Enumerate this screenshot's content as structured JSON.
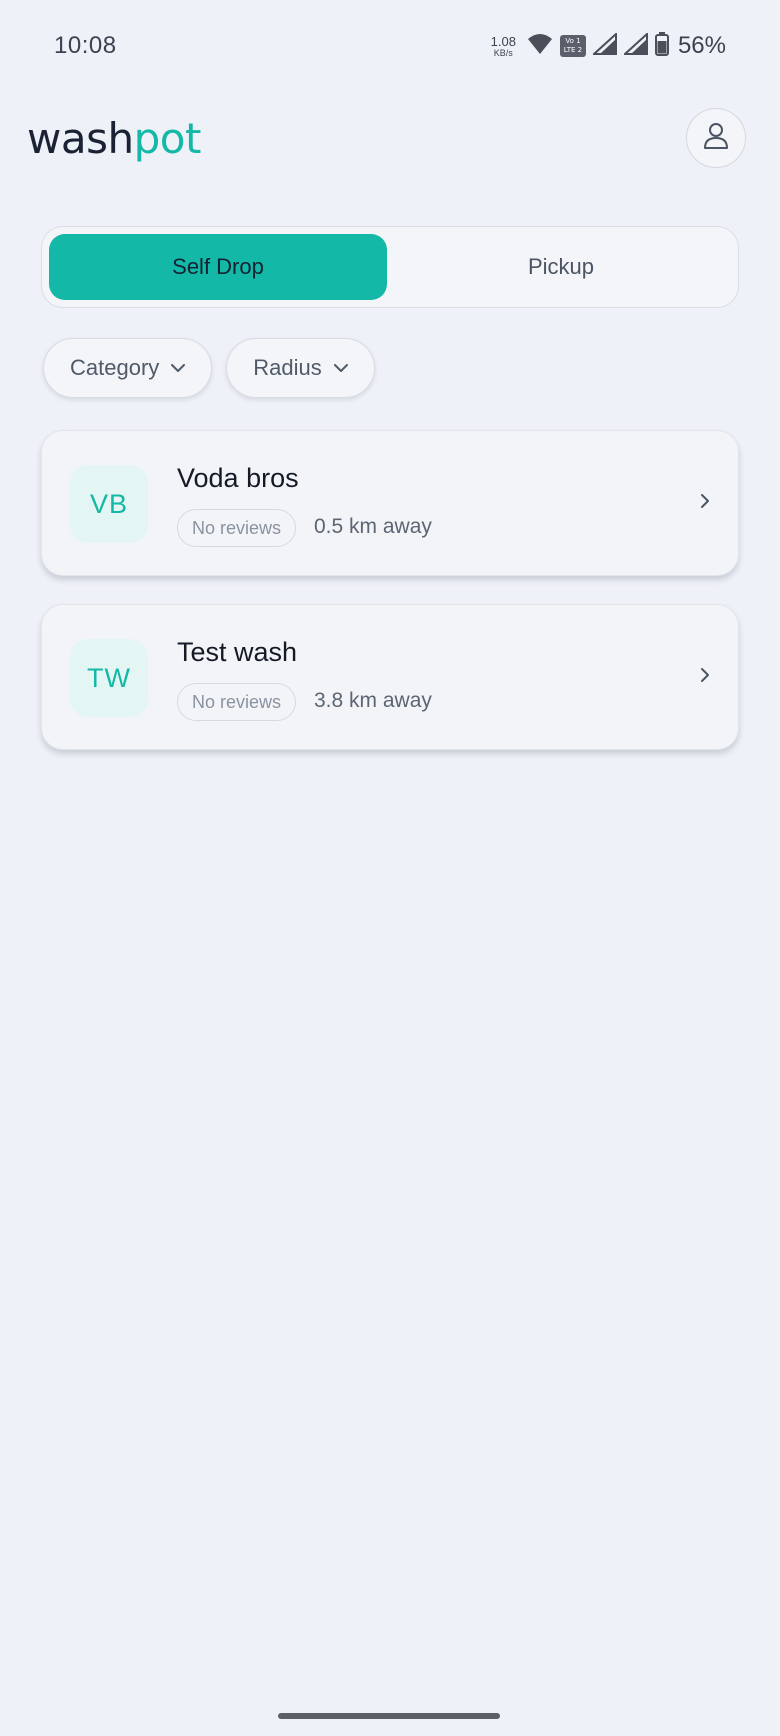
{
  "status_bar": {
    "time": "10:08",
    "net_speed_value": "1.08",
    "net_speed_unit": "KB/s",
    "volte_top": "Vo 1",
    "volte_bottom": "LTE 2",
    "battery_percent": "56%",
    "icons": [
      "wifi-icon",
      "volte-icon",
      "signal-icon",
      "signal-icon",
      "battery-icon"
    ]
  },
  "header": {
    "logo_part1": "wash",
    "logo_part2": "pot",
    "profile_icon": "user-icon"
  },
  "mode_toggle": {
    "options": [
      {
        "label": "Self Drop",
        "selected": true
      },
      {
        "label": "Pickup",
        "selected": false
      }
    ]
  },
  "filters": [
    {
      "label": "Category",
      "icon": "chevron-down-icon"
    },
    {
      "label": "Radius",
      "icon": "chevron-down-icon"
    }
  ],
  "shops": [
    {
      "initials": "VB",
      "name": "Voda bros",
      "reviews": "No reviews",
      "distance": "0.5 km away"
    },
    {
      "initials": "TW",
      "name": "Test wash",
      "reviews": "No reviews",
      "distance": "3.8 km away"
    }
  ],
  "colors": {
    "accent": "#14b8a6",
    "background": "#eef1f7",
    "card": "#f2f4f8"
  }
}
